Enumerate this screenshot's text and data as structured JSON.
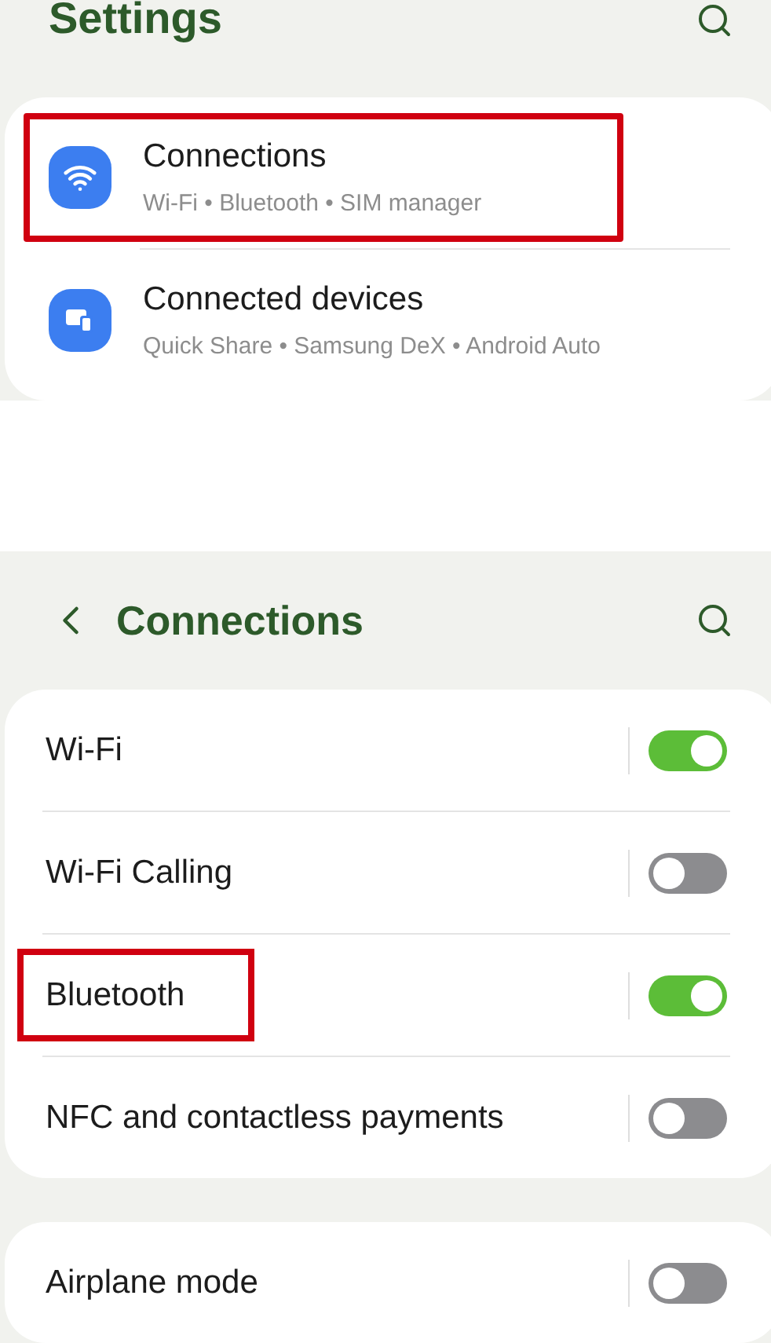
{
  "settings_screen": {
    "title": "Settings",
    "items": [
      {
        "kind": "wifi",
        "title": "Connections",
        "subtitle": "Wi-Fi • Bluetooth • SIM manager",
        "highlighted": true
      },
      {
        "kind": "devices",
        "title": "Connected devices",
        "subtitle": "Quick Share • Samsung DeX • Android Auto",
        "highlighted": false
      }
    ]
  },
  "connections_screen": {
    "title": "Connections",
    "groups": [
      [
        {
          "label": "Wi-Fi",
          "on": true,
          "highlighted": false
        },
        {
          "label": "Wi-Fi Calling",
          "on": false,
          "highlighted": false
        },
        {
          "label": "Bluetooth",
          "on": true,
          "highlighted": true
        },
        {
          "label": "NFC and contactless payments",
          "on": false,
          "highlighted": false
        }
      ],
      [
        {
          "label": "Airplane mode",
          "on": false,
          "highlighted": false
        }
      ]
    ]
  }
}
